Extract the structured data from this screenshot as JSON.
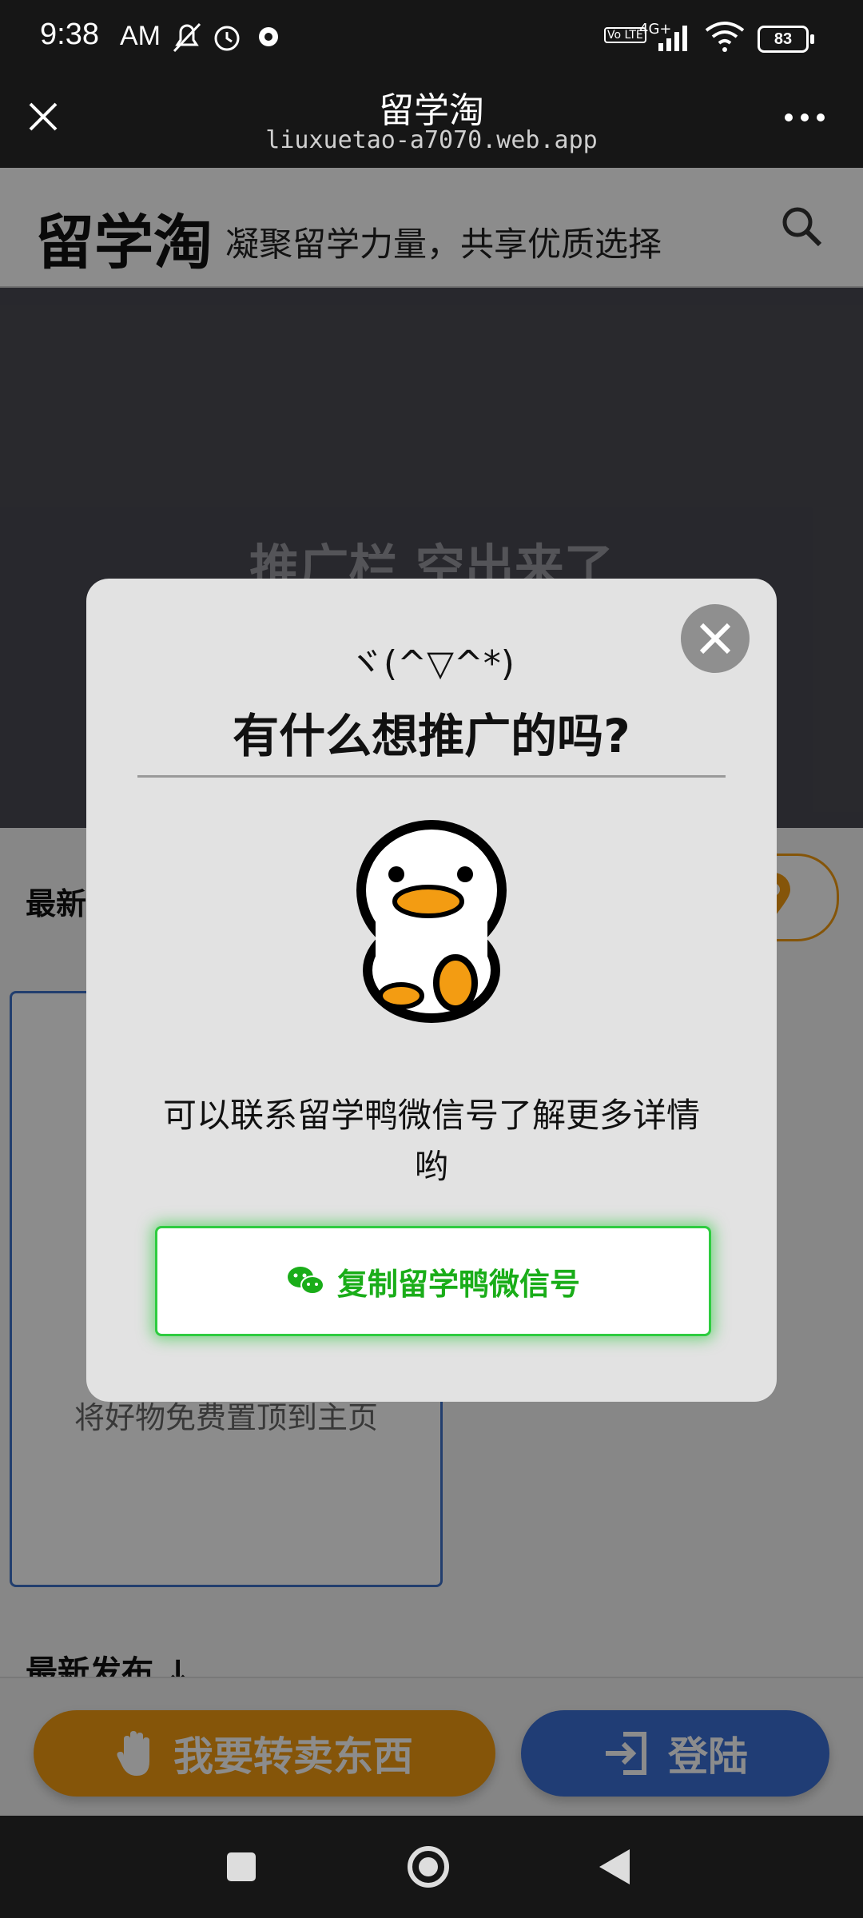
{
  "status_bar": {
    "time": "9:38",
    "ampm": "AM",
    "battery": "83",
    "network": "4G+",
    "volte": "Vo LTE"
  },
  "title_bar": {
    "title": "留学淘",
    "url": "liuxuetao-a7070.web.app"
  },
  "site": {
    "logo": "留学淘",
    "slogan": "凝聚留学力量，共享优质选择",
    "banner_text": "推广栏 空出来了",
    "latest_label": "最新",
    "card_text": "将好物免费置顶到主页",
    "recent_label": "最新发布 ↓"
  },
  "bottom_actions": {
    "sell_label": "我要转卖东西",
    "login_label": "登陆"
  },
  "modal": {
    "kaomoji": "ヾ(^▽^*)",
    "title": "有什么想推广的吗?",
    "message": "可以联系留学鸭微信号了解更多详情哟",
    "copy_button": "复制留学鸭微信号"
  },
  "colors": {
    "sell": "#f39c12",
    "login": "#3b6fd6",
    "wechat_green": "#1aad19"
  }
}
